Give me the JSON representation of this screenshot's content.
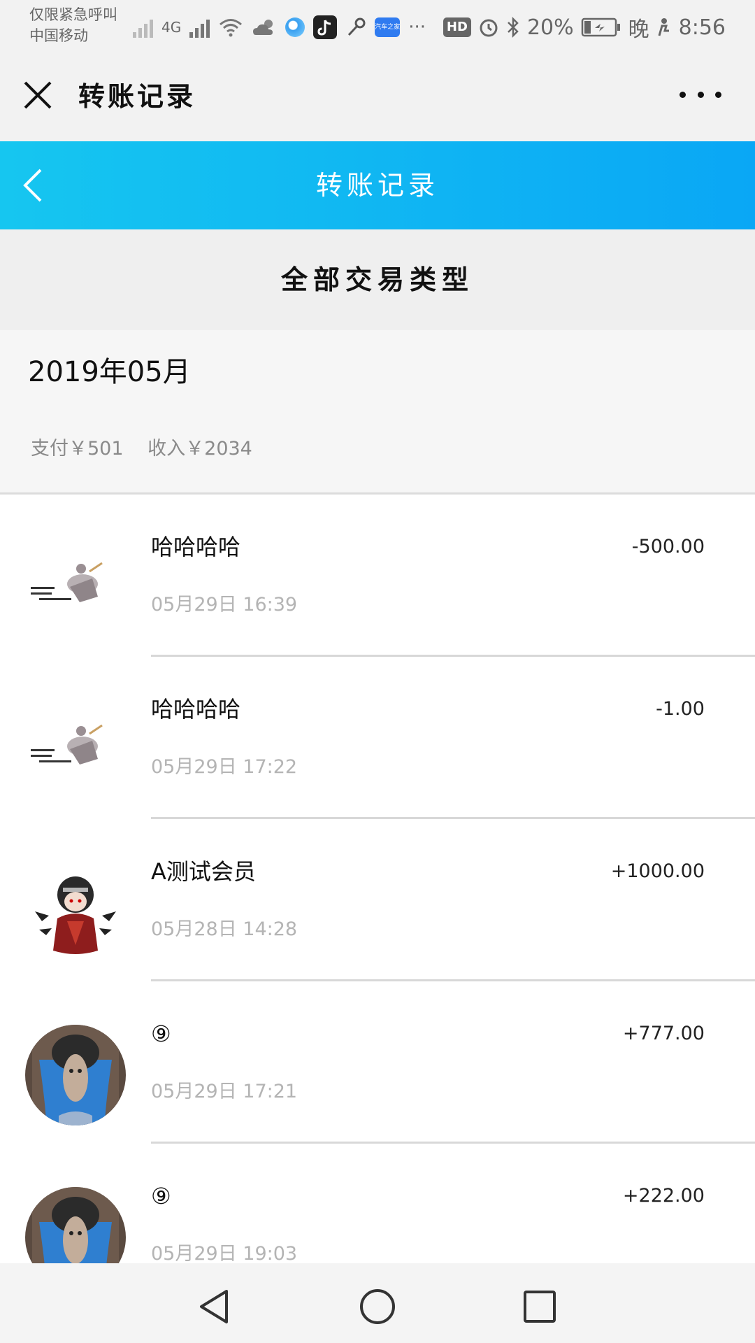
{
  "status_bar": {
    "carrier_line1": "仅限紧急呼叫",
    "carrier_line2": "中国移动",
    "network": "4G",
    "app_badge": "汽车之家",
    "overflow": "···",
    "hd": "HD",
    "battery": "20%",
    "night": "晚",
    "time": "8:56"
  },
  "title_bar": {
    "title": "转账记录"
  },
  "header": {
    "title": "转账记录"
  },
  "filter": {
    "label": "全部交易类型"
  },
  "month": {
    "title": "2019年05月",
    "pay": "支付￥501",
    "income": "收入￥2034"
  },
  "transactions": [
    {
      "name": "哈哈哈哈",
      "amount": "-500.00",
      "time": "05月29日 16:39",
      "avatar": "figure-avatar"
    },
    {
      "name": "哈哈哈哈",
      "amount": "-1.00",
      "time": "05月29日 17:22",
      "avatar": "figure-avatar"
    },
    {
      "name": "A测试会员",
      "amount": "+1000.00",
      "time": "05月28日 14:28",
      "avatar": "anime-avatar"
    },
    {
      "name": "⑨",
      "amount": "+777.00",
      "time": "05月29日 17:21",
      "avatar": "sleeping-avatar"
    },
    {
      "name": "⑨",
      "amount": "+222.00",
      "time": "05月29日 19:03",
      "avatar": "sleeping-avatar"
    }
  ],
  "colors": {
    "header_start": "#16c6f0",
    "header_end": "#0aa7f5"
  }
}
